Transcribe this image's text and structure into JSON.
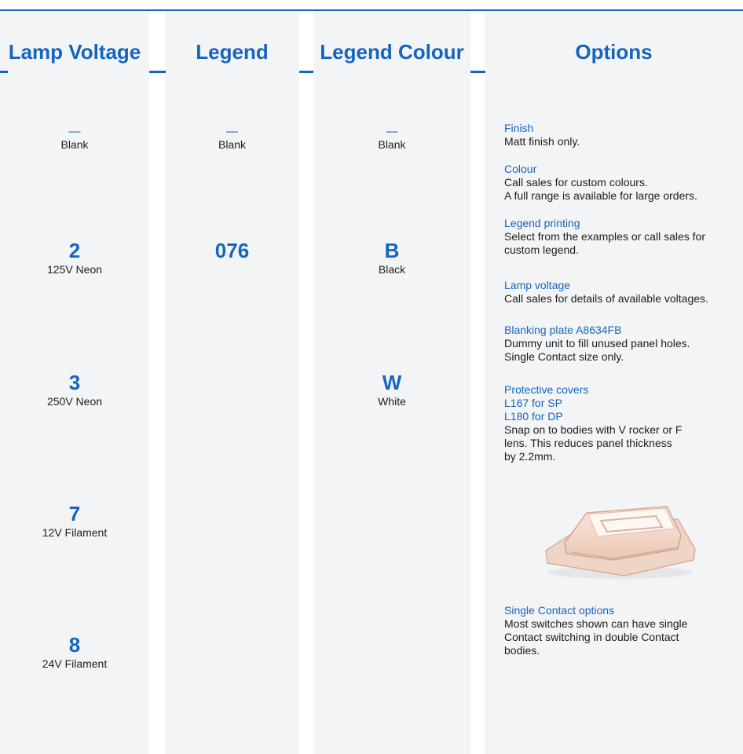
{
  "columns": {
    "lamp_voltage": {
      "header": "Lamp Voltage",
      "items": [
        {
          "code": "—",
          "label": "Blank"
        },
        {
          "code": "2",
          "label": "125V Neon"
        },
        {
          "code": "3",
          "label": "250V Neon"
        },
        {
          "code": "7",
          "label": "12V Filament"
        },
        {
          "code": "8",
          "label": "24V Filament"
        }
      ]
    },
    "legend": {
      "header": "Legend",
      "items": [
        {
          "code": "—",
          "label": "Blank"
        },
        {
          "code": "076",
          "label": ""
        }
      ]
    },
    "legend_colour": {
      "header": "Legend Colour",
      "items": [
        {
          "code": "—",
          "label": "Blank"
        },
        {
          "code": "B",
          "label": "Black"
        },
        {
          "code": "W",
          "label": "White"
        }
      ]
    },
    "options": {
      "header": "Options",
      "sections": [
        {
          "title": "Finish",
          "lines": [
            "Matt finish only."
          ]
        },
        {
          "title": "Colour",
          "lines": [
            "Call sales for custom colours.",
            "A full range is available for large orders."
          ]
        },
        {
          "title": "Legend printing",
          "lines": [
            "Select from the examples or call sales for",
            "custom legend."
          ]
        },
        {
          "title": "Lamp voltage",
          "lines": [
            "Call sales for details of available voltages."
          ]
        },
        {
          "title": "Blanking plate A8634FB",
          "lines": [
            "Dummy unit to fill unused panel holes.",
            "Single Contact size only."
          ]
        },
        {
          "title": "Protective covers",
          "subtitles": [
            "L167 for SP",
            "L180 for DP"
          ],
          "lines": [
            "Snap on to bodies with V rocker or F",
            "lens. This reduces panel thickness",
            "by 2.2mm."
          ]
        },
        {
          "title": "Single Contact options",
          "lines": [
            "Most switches shown can have single",
            "Contact switching in double Contact",
            "bodies."
          ]
        }
      ]
    }
  },
  "colors": {
    "accent": "#1565c0",
    "panel": "#f3f4f5",
    "text": "#1d1d1b"
  }
}
